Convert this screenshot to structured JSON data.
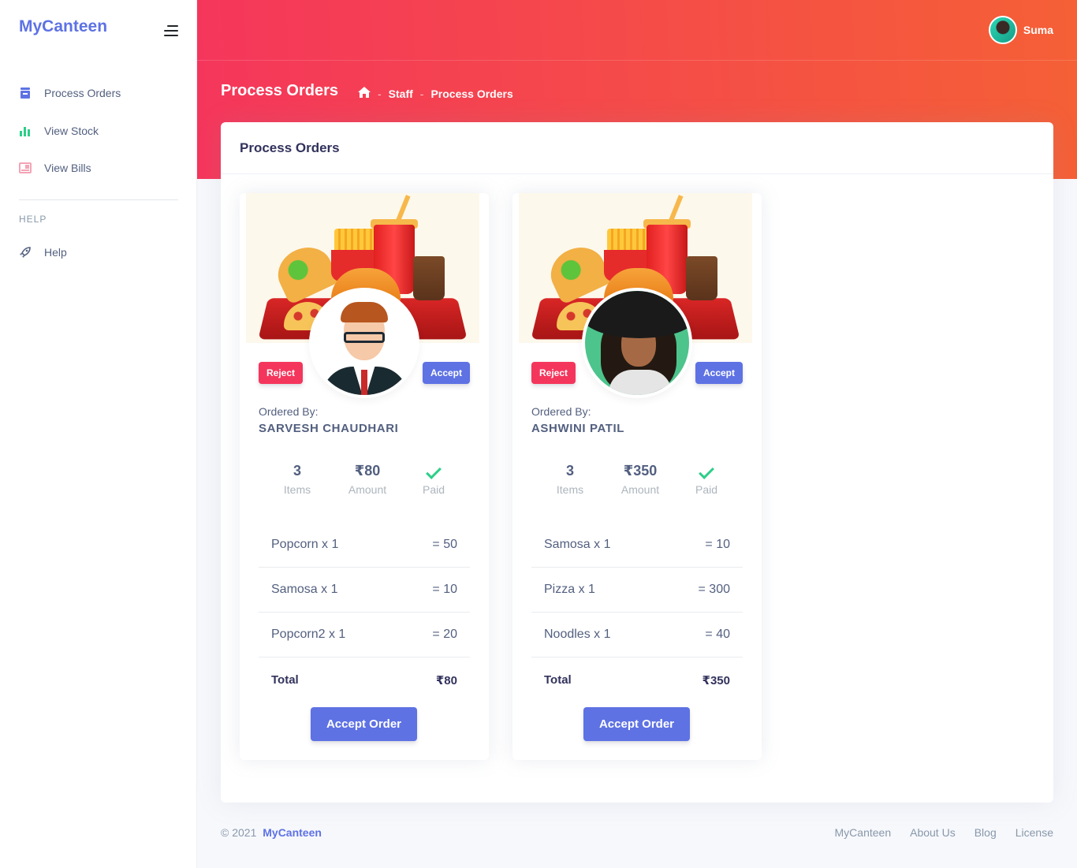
{
  "app": {
    "brand": "MyCanteen",
    "accent": "#5e72e4",
    "danger": "#f5365c",
    "success": "#2dce89"
  },
  "sidebar": {
    "items": [
      {
        "label": "Process Orders",
        "icon": "box-icon",
        "color": "#5e72e4"
      },
      {
        "label": "View Stock",
        "icon": "bar-chart-icon",
        "color": "#2dce89"
      },
      {
        "label": "View Bills",
        "icon": "bill-icon",
        "color": "#f3a4b5"
      }
    ],
    "help_heading": "HELP",
    "help_items": [
      {
        "label": "Help",
        "icon": "rocket-icon",
        "color": "#525f7f"
      }
    ]
  },
  "header": {
    "user_name": "Suma",
    "page_title": "Process Orders",
    "breadcrumb": [
      "Staff",
      "Process Orders"
    ],
    "breadcrumb_sep": "-"
  },
  "main": {
    "card_title": "Process Orders",
    "orders": [
      {
        "reject_label": "Reject",
        "accept_label": "Accept",
        "ordered_by_label": "Ordered By:",
        "customer": "SARVESH CHAUDHARI",
        "items_count": "3",
        "items_label": "Items",
        "amount": "₹80",
        "amount_label": "Amount",
        "paid_label": "Paid",
        "lines": [
          {
            "name": "Popcorn x 1",
            "price": "= 50"
          },
          {
            "name": "Samosa x 1",
            "price": "= 10"
          },
          {
            "name": "Popcorn2 x 1",
            "price": "= 20"
          }
        ],
        "total_label": "Total",
        "total": "₹80",
        "accept_order_label": "Accept Order"
      },
      {
        "reject_label": "Reject",
        "accept_label": "Accept",
        "ordered_by_label": "Ordered By:",
        "customer": "ASHWINI PATIL",
        "items_count": "3",
        "items_label": "Items",
        "amount": "₹350",
        "amount_label": "Amount",
        "paid_label": "Paid",
        "lines": [
          {
            "name": "Samosa x 1",
            "price": "= 10"
          },
          {
            "name": "Pizza x 1",
            "price": "= 300"
          },
          {
            "name": "Noodles x 1",
            "price": "= 40"
          }
        ],
        "total_label": "Total",
        "total": "₹350",
        "accept_order_label": "Accept Order"
      }
    ]
  },
  "footer": {
    "copyright": "© 2021",
    "brand_link": "MyCanteen",
    "links": [
      "MyCanteen",
      "About Us",
      "Blog",
      "License"
    ]
  }
}
